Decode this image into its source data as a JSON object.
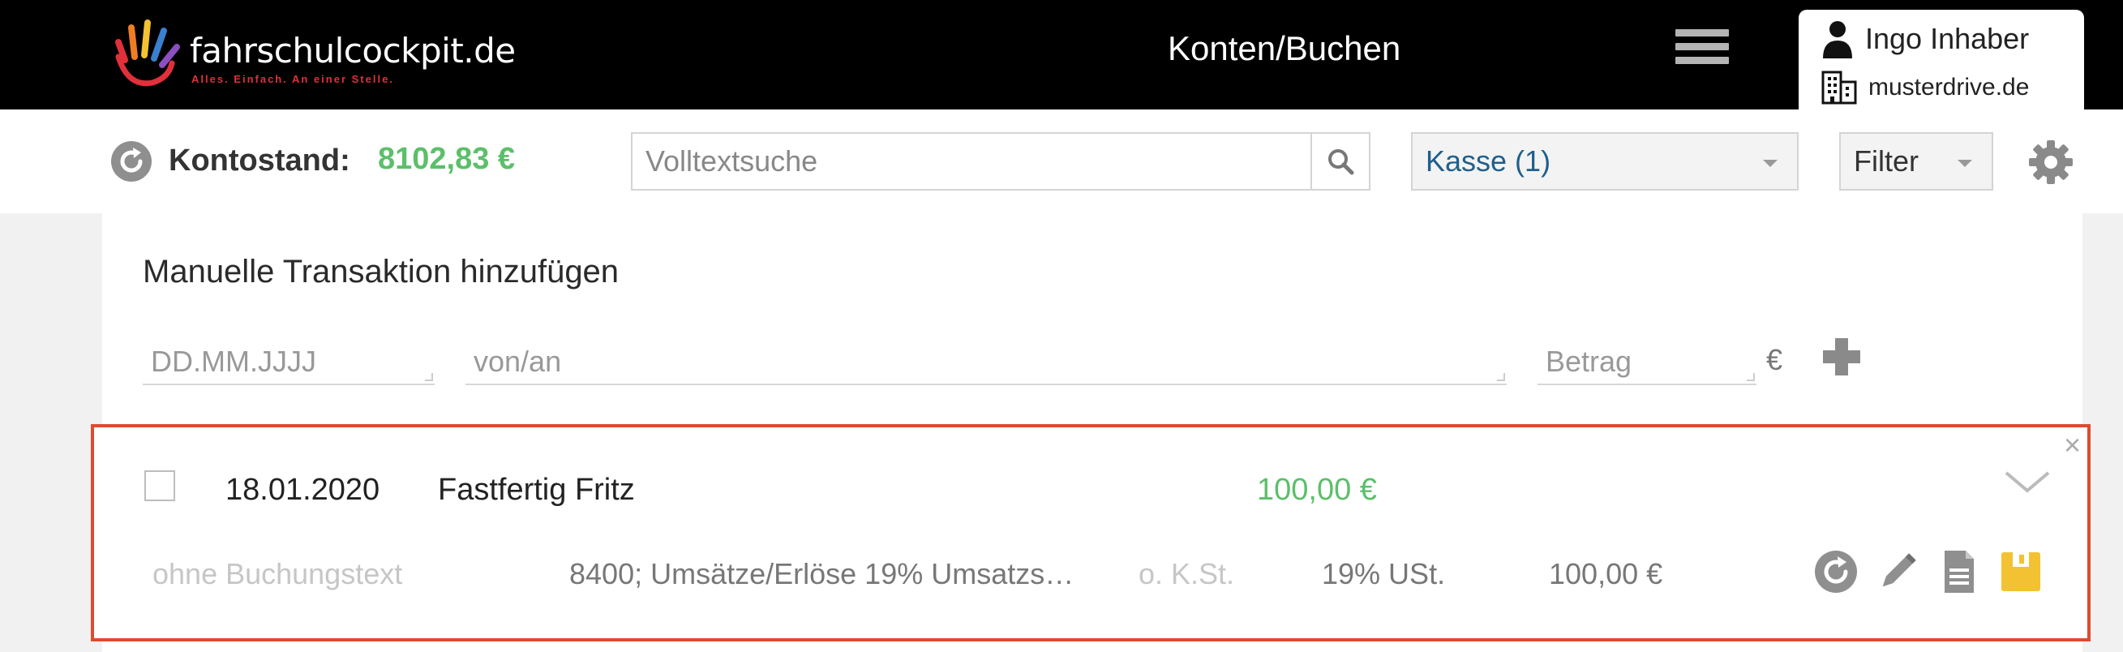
{
  "header": {
    "logo_text": "fahrschulcockpit.de",
    "logo_slogan": "Alles. Einfach. An einer Stelle.",
    "page_title": "Konten/Buchen",
    "user_name": "Ingo Inhaber",
    "user_org": "musterdrive.de"
  },
  "toolbar": {
    "kontostand_label": "Kontostand:",
    "kontostand_value": "8102,83 €",
    "search_placeholder": "Volltextsuche",
    "account_select": "Kasse (1)",
    "filter_select": "Filter"
  },
  "add_form": {
    "title": "Manuelle Transaktion hinzufügen",
    "date_placeholder": "DD.MM.JJJJ",
    "party_placeholder": "von/an",
    "amount_placeholder": "Betrag",
    "currency": "€"
  },
  "transaction": {
    "date": "18.01.2020",
    "name": "Fastfertig Fritz",
    "amount": "100,00 €",
    "booking_text": "ohne Buchungstext",
    "account": "8400; Umsätze/Erlöse 19% Umsatzs…",
    "cost_center": "o. K.St.",
    "tax": "19% USt.",
    "net_amount": "100,00 €",
    "close_glyph": "×"
  },
  "colors": {
    "positive": "#5cbf6a",
    "highlight_border": "#e04a2f",
    "link_blue": "#1f5f8b",
    "receipt_yellow": "#f2c232"
  },
  "icons": [
    "refresh-icon",
    "search-icon",
    "gear-icon",
    "user-icon",
    "building-icon",
    "menu-icon",
    "plus-icon",
    "close-icon",
    "chevron-down-icon",
    "pencil-icon",
    "document-icon",
    "receipt-icon"
  ]
}
